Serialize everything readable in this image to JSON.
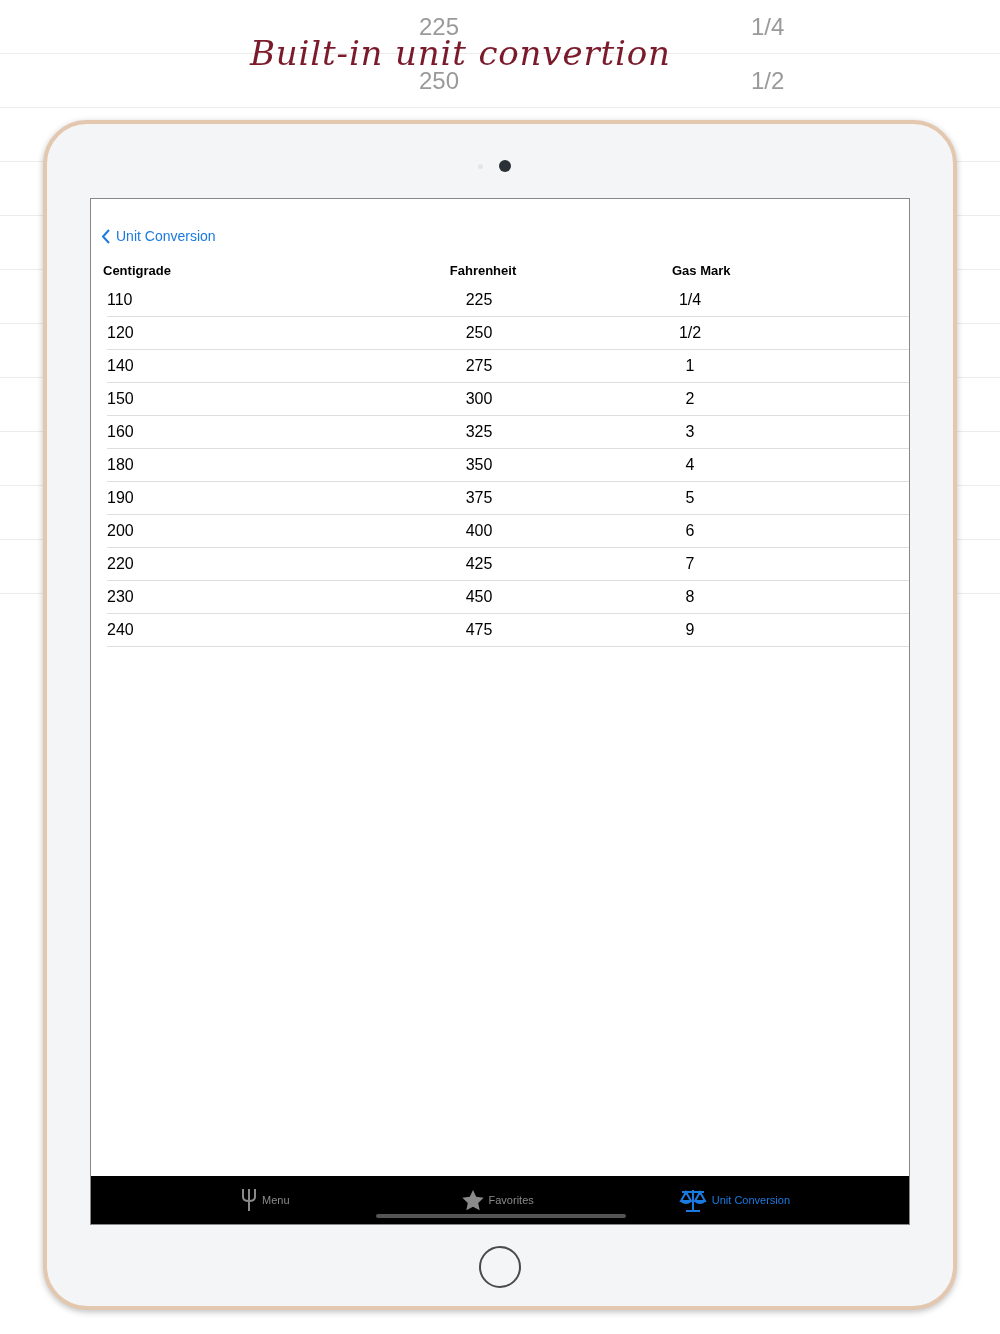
{
  "caption": "Built-in unit convertion",
  "background_rows": [
    {
      "fahrenheit": "225",
      "gas_mark": "1/4"
    },
    {
      "fahrenheit": "250",
      "gas_mark": "1/2"
    }
  ],
  "nav": {
    "back_label": "Unit Conversion"
  },
  "table": {
    "columns": [
      "Centigrade",
      "Fahrenheit",
      "Gas Mark"
    ],
    "rows": [
      [
        "110",
        "225",
        "1/4"
      ],
      [
        "120",
        "250",
        "1/2"
      ],
      [
        "140",
        "275",
        "1"
      ],
      [
        "150",
        "300",
        "2"
      ],
      [
        "160",
        "325",
        "3"
      ],
      [
        "180",
        "350",
        "4"
      ],
      [
        "190",
        "375",
        "5"
      ],
      [
        "200",
        "400",
        "6"
      ],
      [
        "220",
        "425",
        "7"
      ],
      [
        "230",
        "450",
        "8"
      ],
      [
        "240",
        "475",
        "9"
      ]
    ]
  },
  "tab_bar": [
    {
      "label": "Menu",
      "kind": "fork",
      "selected": false
    },
    {
      "label": "Favorites",
      "kind": "star",
      "selected": false
    },
    {
      "label": "Unit Conversion",
      "kind": "scale",
      "selected": true
    }
  ]
}
